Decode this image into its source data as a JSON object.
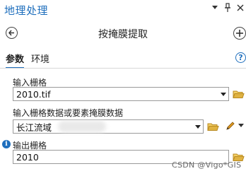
{
  "window": {
    "title": "地理处理",
    "controls": [
      "menu-icon",
      "pin-icon",
      "close-icon"
    ]
  },
  "tool": {
    "title": "按掩膜提取"
  },
  "tabs": [
    {
      "label": "参数",
      "active": true
    },
    {
      "label": "环境",
      "active": false
    }
  ],
  "params": {
    "input_raster": {
      "label": "输入栅格",
      "value": "2010.tif"
    },
    "mask": {
      "label": "输入栅格数据或要素掩膜数据",
      "value": "长江流域"
    },
    "output_raster": {
      "label": "输出栅格",
      "value": "2010"
    }
  },
  "watermark": "CSDN @Vigo*GIS",
  "colors": {
    "accent": "#1f6fbd",
    "folder": "#e0b342",
    "pencil": "#e8a020"
  }
}
